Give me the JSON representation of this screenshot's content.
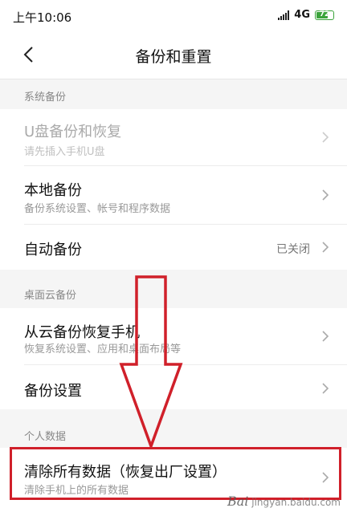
{
  "status": {
    "time": "上午10:06",
    "network": "4G",
    "battery": "72",
    "battery_level": 0.72
  },
  "header": {
    "title": "备份和重置"
  },
  "sections": {
    "system": {
      "label": "系统备份"
    },
    "cloud": {
      "label": "桌面云备份"
    },
    "personal": {
      "label": "个人数据"
    }
  },
  "items": {
    "usb": {
      "title": "U盘备份和恢复",
      "subtitle": "请先插入手机U盘"
    },
    "local": {
      "title": "本地备份",
      "subtitle": "备份系统设置、帐号和程序数据"
    },
    "auto": {
      "title": "自动备份",
      "value": "已关闭"
    },
    "cloud_restore": {
      "title": "从云备份恢复手机",
      "subtitle": "恢复系统设置、应用和桌面布局等"
    },
    "backup_settings": {
      "title": "备份设置"
    },
    "factory_reset": {
      "title": "清除所有数据（恢复出厂设置）",
      "subtitle": "清除手机上的所有数据"
    }
  },
  "watermark": {
    "text": "Bai",
    "sub": "jingyan.baidu.com"
  },
  "colors": {
    "annotation_red": "#d0202a",
    "battery_green": "#3aa33a"
  }
}
